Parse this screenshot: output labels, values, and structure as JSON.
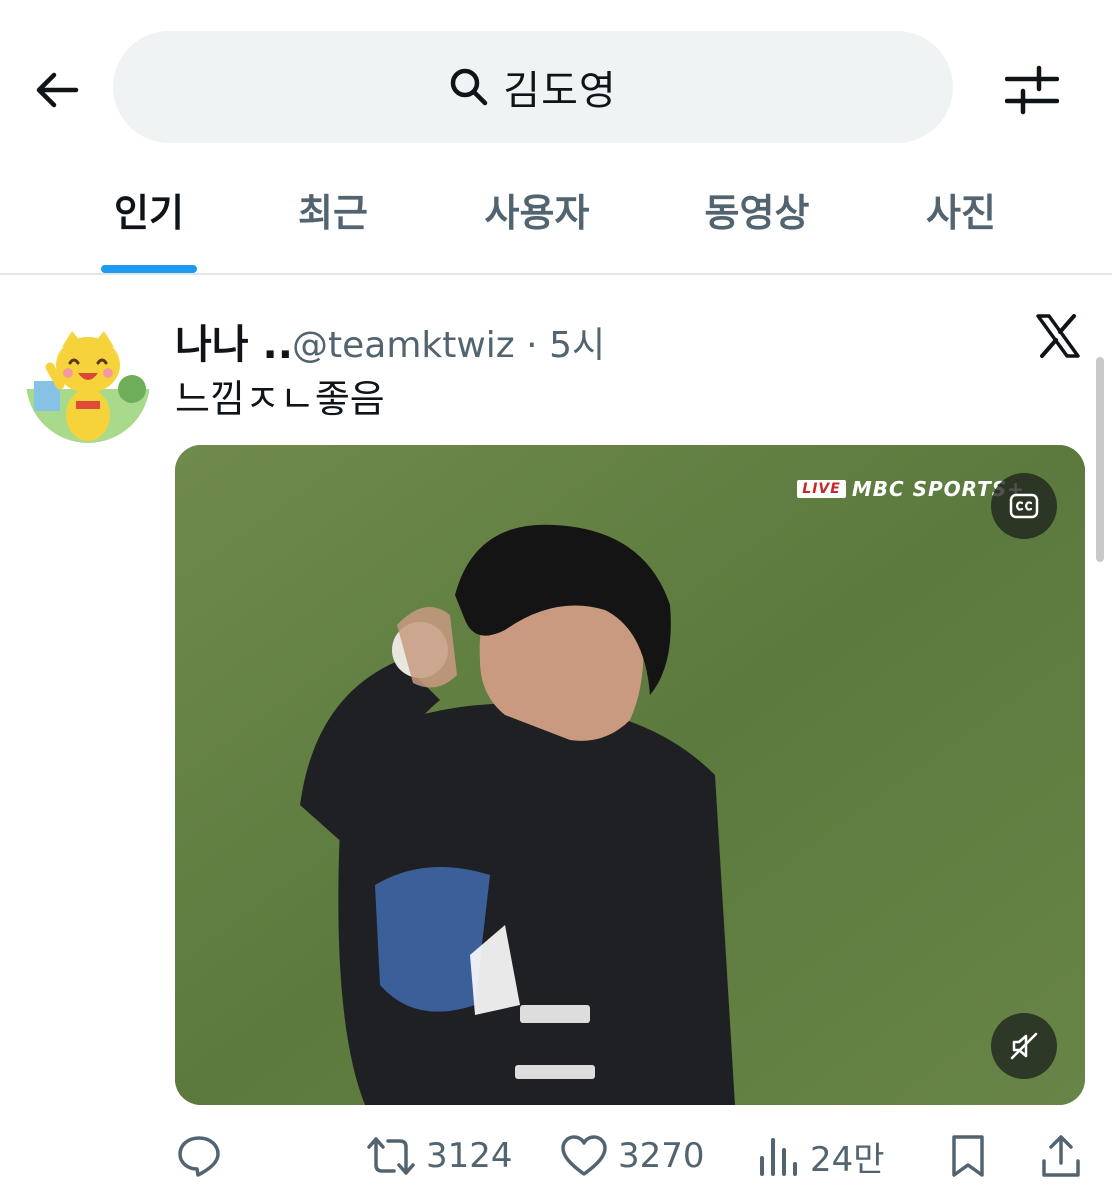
{
  "search": {
    "query": "김도영"
  },
  "tabs": [
    {
      "label": "인기"
    },
    {
      "label": "최근"
    },
    {
      "label": "사용자"
    },
    {
      "label": "동영상"
    },
    {
      "label": "사진"
    }
  ],
  "tweet": {
    "display_name": "나나 ..",
    "handle": "@teamktwiz",
    "separator": "·",
    "time": "5시",
    "text": "느낌ㅈㄴ좋음",
    "media": {
      "overlay_live": "LIVE",
      "overlay_brand": "MBC SPORTS+"
    },
    "stats": {
      "reposts": "3124",
      "likes": "3270",
      "views": "24만"
    }
  },
  "colors": {
    "accent": "#1d9bf0",
    "text_primary": "#0f1419",
    "text_secondary": "#536471",
    "search_bg": "#eff3f4"
  },
  "icons": [
    "back-arrow-icon",
    "search-icon",
    "filter-sliders-icon",
    "x-logo-icon",
    "captions-icon",
    "mute-icon",
    "reply-icon",
    "repost-icon",
    "like-icon",
    "views-icon",
    "bookmark-icon",
    "share-icon"
  ]
}
